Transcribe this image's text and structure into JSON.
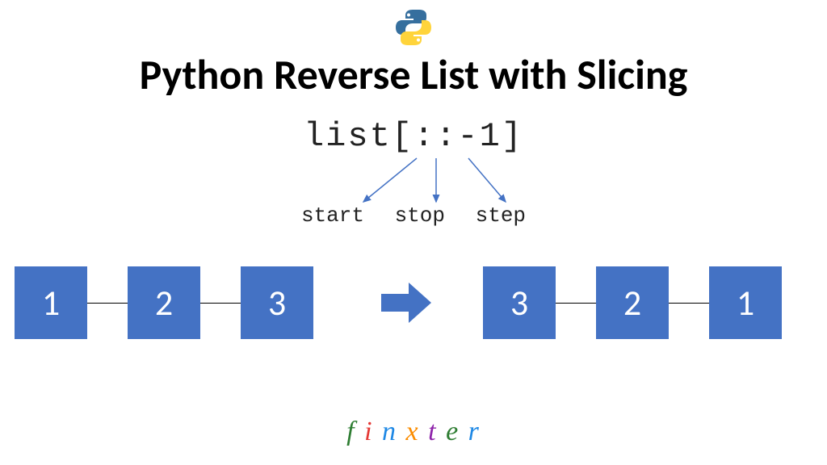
{
  "title": "Python Reverse List with Slicing",
  "code_expression": "list[::-1]",
  "slice_labels": {
    "start": "start",
    "stop": "stop",
    "step": "step"
  },
  "list_before": [
    "1",
    "2",
    "3"
  ],
  "list_after": [
    "3",
    "2",
    "1"
  ],
  "colors": {
    "node_fill": "#4472c4",
    "arrow_fill": "#4472c4",
    "annotation_arrow": "#4472c4",
    "python_blue": "#366f9e",
    "python_yellow": "#ffd43b"
  },
  "brand": {
    "letters": [
      {
        "ch": "f",
        "color": "#2e7d32"
      },
      {
        "ch": "i",
        "color": "#e53935"
      },
      {
        "ch": "n",
        "color": "#1e88e5"
      },
      {
        "ch": "x",
        "color": "#fb8c00"
      },
      {
        "ch": "t",
        "color": "#8e24aa"
      },
      {
        "ch": "e",
        "color": "#2e7d32"
      },
      {
        "ch": "r",
        "color": "#1e88e5"
      }
    ]
  },
  "layout": {
    "node_size": 90,
    "before_x": [
      18,
      158,
      298
    ],
    "after_x": [
      598,
      738,
      878
    ],
    "connector_before_x": [
      108,
      248
    ],
    "connector_after_x": [
      688,
      828
    ]
  }
}
